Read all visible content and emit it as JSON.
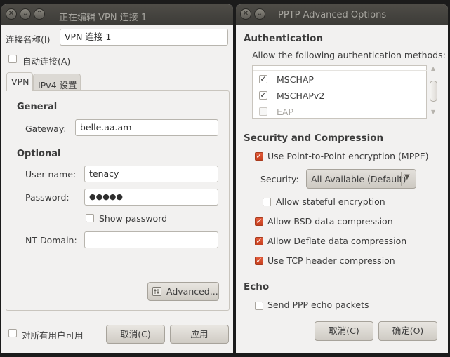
{
  "left_window": {
    "title": "正在编辑 VPN 连接 1",
    "connection_name_label": "连接名称(I)",
    "connection_name_value": "VPN 连接 1",
    "auto_connect_label": "自动连接(A)",
    "tabs": [
      {
        "label": "VPN"
      },
      {
        "label": "IPv4 设置"
      }
    ],
    "general_header": "General",
    "gateway_label": "Gateway:",
    "gateway_value": "belle.aa.am",
    "optional_header": "Optional",
    "username_label": "User name:",
    "username_value": "tenacy",
    "password_label": "Password:",
    "password_value": "●●●●●",
    "show_password_label": "Show password",
    "nt_domain_label": "NT Domain:",
    "nt_domain_value": "",
    "advanced_button": "Advanced...",
    "all_users_label": "对所有用户可用",
    "cancel_button": "取消(C)",
    "apply_button": "应用"
  },
  "right_window": {
    "title": "PPTP Advanced Options",
    "auth_header": "Authentication",
    "auth_desc": "Allow the following authentication methods:",
    "auth_methods": [
      {
        "label": "MSCHAP",
        "checked": true
      },
      {
        "label": "MSCHAPv2",
        "checked": true
      },
      {
        "label": "EAP",
        "checked": false
      }
    ],
    "security_header": "Security and Compression",
    "mppe_label": "Use Point-to-Point encryption (MPPE)",
    "security_label": "Security:",
    "security_value": "All Available (Default)",
    "stateful_label": "Allow stateful encryption",
    "bsd_label": "Allow BSD data compression",
    "deflate_label": "Allow Deflate data compression",
    "tcp_label": "Use TCP header compression",
    "echo_header": "Echo",
    "echo_label": "Send PPP echo packets",
    "cancel_button": "取消(C)",
    "ok_button": "确定(O)"
  }
}
